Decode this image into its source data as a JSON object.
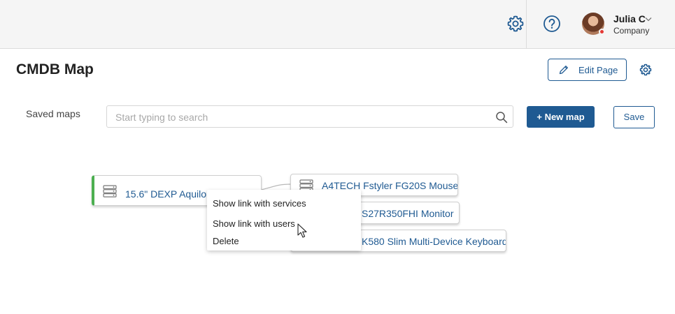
{
  "header": {
    "settings_icon": "gear-icon",
    "help_icon": "question-circle-icon",
    "user": {
      "name": "Julia C",
      "company": "Company",
      "status_color": "#e53935"
    }
  },
  "page": {
    "title": "CMDB Map",
    "edit_label": "Edit Page"
  },
  "toolbar": {
    "saved_maps_label": "Saved maps",
    "search_placeholder": "Start typing to search",
    "search_value": "",
    "new_map_label": "+ New map",
    "save_label": "Save"
  },
  "map": {
    "root": {
      "label": "15.6\" DEXP Aquilon l"
    },
    "children": [
      {
        "label": "A4TECH Fstyler FG20S Mouse"
      },
      {
        "label": "S27R350FHI Monitor"
      },
      {
        "label": "K580 Slim Multi-Device Keyboard"
      }
    ]
  },
  "context_menu": {
    "items": [
      "Show link with services",
      "Show link with users",
      "Delete"
    ]
  },
  "colors": {
    "accent": "#1f5a92",
    "root_marker": "#4caf50"
  }
}
